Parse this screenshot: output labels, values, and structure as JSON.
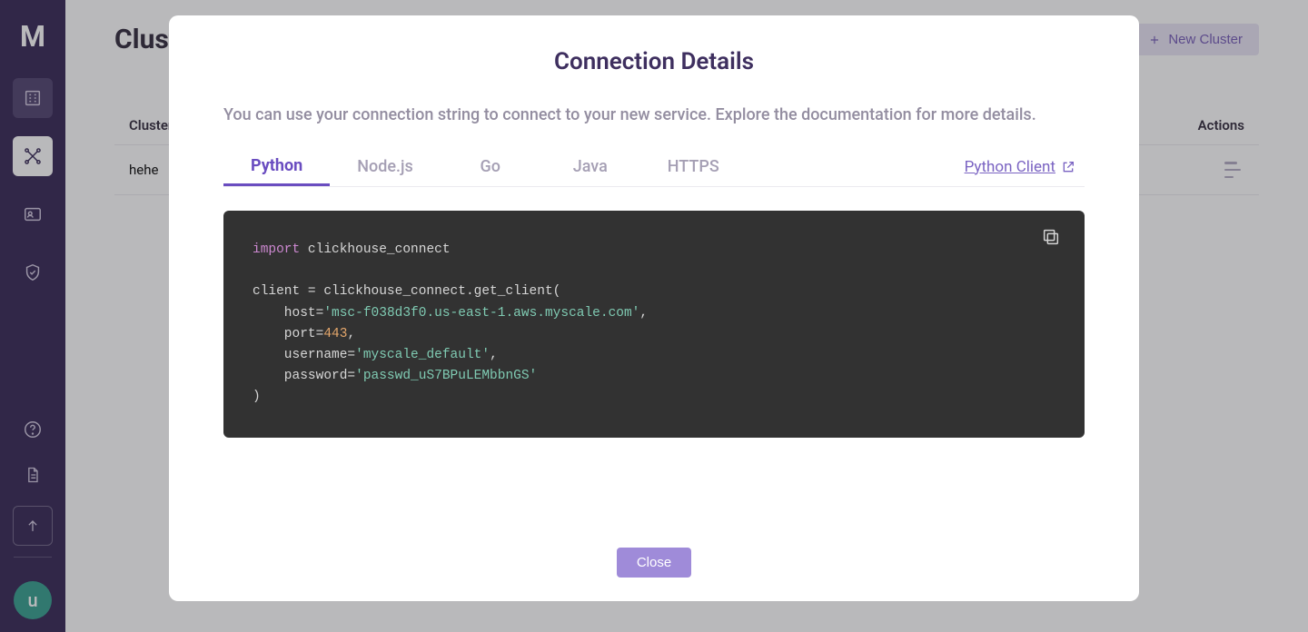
{
  "sidebar": {
    "logo_letter": "M",
    "avatar_letter": "u"
  },
  "page": {
    "title": "Clusters",
    "new_cluster_label": "New Cluster",
    "table": {
      "header_name": "Cluster",
      "header_actions": "Actions",
      "rows": [
        {
          "name": "hehe"
        }
      ]
    }
  },
  "modal": {
    "title": "Connection Details",
    "subtitle": "You can use your connection string to connect to your new service. Explore the documentation for more details.",
    "tabs": {
      "python": "Python",
      "nodejs": "Node.js",
      "go": "Go",
      "java": "Java",
      "https": "HTTPS"
    },
    "doc_link_label": "Python Client",
    "code": {
      "kw": "import",
      "mod": "clickhouse_connect",
      "line1a": "client = clickhouse_connect.get_client(",
      "host_key": "    host=",
      "host_val": "'msc-f038d3f0.us-east-1.aws.myscale.com'",
      "port_key": "    port=",
      "port_val": "443",
      "user_key": "    username=",
      "user_val": "'myscale_default'",
      "pass_key": "    password=",
      "pass_val": "'passwd_uS7BPuLEMbbnGS'",
      "close": ")"
    },
    "close_label": "Close"
  }
}
